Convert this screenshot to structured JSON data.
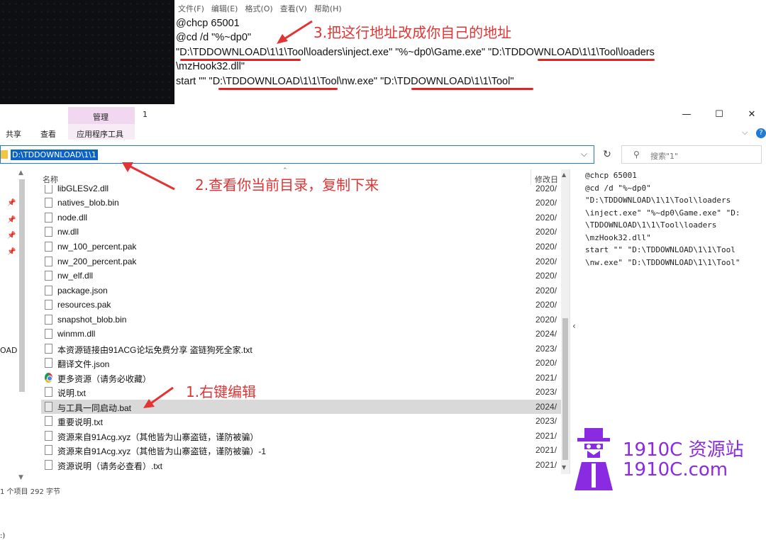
{
  "notepad": {
    "menu": [
      "文件(F)",
      "编辑(E)",
      "格式(O)",
      "查看(V)",
      "帮助(H)"
    ],
    "lines": [
      "@chcp 65001",
      "@cd /d \"%~dp0\"",
      "\"D:\\TDDOWNLOAD\\1\\1\\Tool\\loaders\\inject.exe\" \"%~dp0\\Game.exe\" \"D:\\TDDOWNLOAD\\1\\1\\Tool\\loaders",
      "\\mzHook32.dll\"",
      "start \"\" \"D:\\TDDOWNLOAD\\1\\1\\Tool\\nw.exe\" \"D:\\TDDOWNLOAD\\1\\1\\Tool\""
    ]
  },
  "annotations": {
    "step3": "3.把这行地址改成你自己的地址",
    "step2": "2.查看你当前目录，复制下来",
    "step1": "1.右键编辑",
    "color": "#e23434"
  },
  "ribbon": {
    "manage_tab": "管理",
    "window_title": "1",
    "share_tab": "共享",
    "view_tab": "查看",
    "app_tools_tab": "应用程序工具",
    "accent": "#f2d7f0"
  },
  "window_controls": {
    "minimize": "—",
    "maximize": "☐",
    "close": "✕"
  },
  "address_bar": {
    "path": "D:\\TDDOWNLOAD\\1\\1",
    "dropdown": "⌵",
    "refresh": "↻"
  },
  "search": {
    "placeholder": "搜索\"1\"",
    "icon": "⚲"
  },
  "file_list": {
    "col_name": "名称",
    "col_modified": "修改日",
    "files": [
      {
        "name": "libGLESv2.dll",
        "date": "2020/",
        "icon": "dll"
      },
      {
        "name": "natives_blob.bin",
        "date": "2020/",
        "icon": "file"
      },
      {
        "name": "node.dll",
        "date": "2020/",
        "icon": "dll"
      },
      {
        "name": "nw.dll",
        "date": "2020/",
        "icon": "dll"
      },
      {
        "name": "nw_100_percent.pak",
        "date": "2020/",
        "icon": "file"
      },
      {
        "name": "nw_200_percent.pak",
        "date": "2020/",
        "icon": "file"
      },
      {
        "name": "nw_elf.dll",
        "date": "2020/",
        "icon": "dll"
      },
      {
        "name": "package.json",
        "date": "2020/",
        "icon": "file"
      },
      {
        "name": "resources.pak",
        "date": "2020/",
        "icon": "file"
      },
      {
        "name": "snapshot_blob.bin",
        "date": "2020/",
        "icon": "file"
      },
      {
        "name": "winmm.dll",
        "date": "2024/",
        "icon": "dll"
      },
      {
        "name": "本资源链接由91ACG论坛免费分享 盗链狗死全家.txt",
        "date": "2023/",
        "icon": "txt"
      },
      {
        "name": "翻译文件.json",
        "date": "2020/",
        "icon": "file"
      },
      {
        "name": "更多资源（请务必收藏）",
        "date": "2021/",
        "icon": "chrome"
      },
      {
        "name": "说明.txt",
        "date": "2023/",
        "icon": "txt"
      },
      {
        "name": "与工具一同启动.bat",
        "date": "2024/",
        "icon": "bat",
        "selected": true
      },
      {
        "name": "重要说明.txt",
        "date": "2023/",
        "icon": "txt"
      },
      {
        "name": "资源来自91Acg.xyz（其他皆为山寨盗链，谨防被骗）",
        "date": "2021/",
        "icon": "file"
      },
      {
        "name": "资源来自91Acg.xyz（其他皆为山寨盗链，谨防被骗）-1",
        "date": "2021/",
        "icon": "file"
      },
      {
        "name": "资源说明（请务必查看）.txt",
        "date": "2021/",
        "icon": "txt"
      }
    ]
  },
  "nav_pane": {
    "partial_label": "OAD",
    "bottom_label": ":)"
  },
  "preview": {
    "lines": [
      "@chcp 65001",
      "@cd /d \"%~dp0\"",
      "\"D:\\TDDOWNLOAD\\1\\1\\Tool\\loaders",
      "\\inject.exe\" \"%~dp0\\Game.exe\" \"D:",
      "\\TDDOWNLOAD\\1\\1\\Tool\\loaders",
      "\\mzHook32.dll\"",
      "start \"\" \"D:\\TDDOWNLOAD\\1\\1\\Tool",
      "\\nw.exe\" \"D:\\TDDOWNLOAD\\1\\1\\Tool\""
    ]
  },
  "status_bar": "1 个项目 292 字节",
  "watermark": {
    "line1": "1910C 资源站",
    "line2": "1910C.com",
    "color": "#8a2be2"
  }
}
